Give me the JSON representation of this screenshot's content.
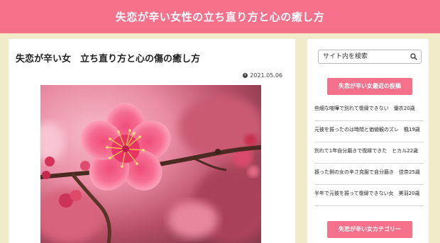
{
  "header": {
    "site_title": "失恋が辛い女性の立ち直り方と心の癒し方"
  },
  "post": {
    "title": "失恋が辛い女　立ち直り方と心の傷の癒し方",
    "date": "2021.05.06",
    "date_icon": "clock-icon",
    "hero_image": "plum-blossom-photo"
  },
  "sidebar": {
    "search": {
      "placeholder": "サイト内を検索",
      "icon": "search-icon"
    },
    "recent_heading": "失恋が辛い女最近の投稿",
    "recent_posts": [
      "些細な喧嘩で別れて復縁できない　優衣20歳",
      "元彼を振ったのは時間と価値観のズレ　楓19歳",
      "別れて1年自分磨きで復縁できた　ヒカル22歳",
      "振った側の女の辛さ克服で自分磨き　佳奈25歳",
      "半年で元彼を振って復縁できない女　美羽20歳"
    ],
    "category_heading": "失恋が辛い女カテゴリー"
  },
  "colors": {
    "accent": "#f5708b",
    "background": "#f2ebc9"
  }
}
